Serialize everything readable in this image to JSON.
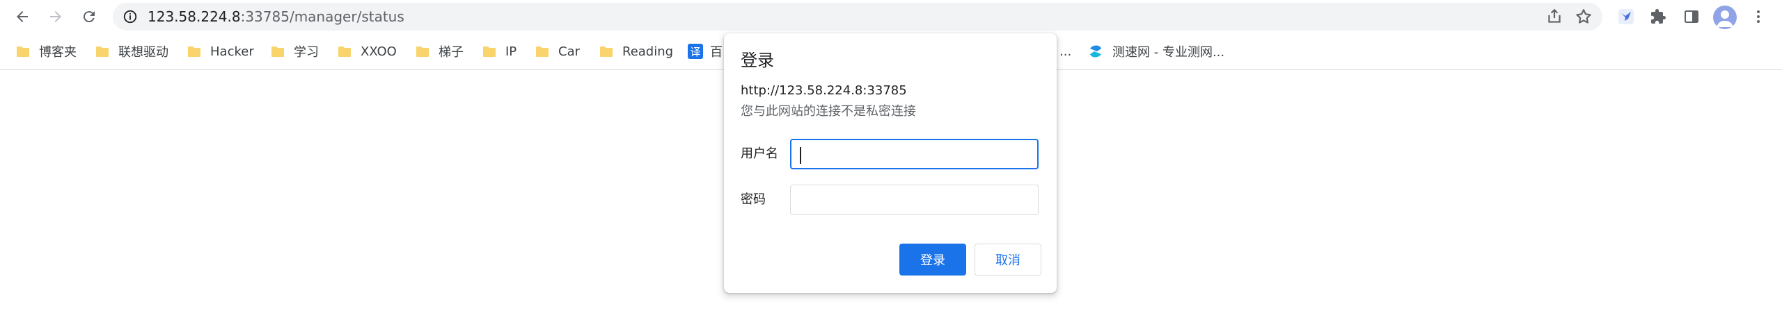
{
  "browser": {
    "url_host": "123.58.224.8",
    "url_rest": ":33785/manager/status"
  },
  "bookmarks": [
    {
      "label": "博客夹",
      "type": "folder"
    },
    {
      "label": "联想驱动",
      "type": "folder"
    },
    {
      "label": "Hacker",
      "type": "folder"
    },
    {
      "label": "学习",
      "type": "folder"
    },
    {
      "label": "XXOO",
      "type": "folder"
    },
    {
      "label": "梯子",
      "type": "folder"
    },
    {
      "label": "IP",
      "type": "folder"
    },
    {
      "label": "Car",
      "type": "folder"
    },
    {
      "label": "Reading",
      "type": "folder"
    },
    {
      "label": "百",
      "type": "translate",
      "icon_text": "译"
    },
    {
      "label": "...",
      "type": "text"
    },
    {
      "label": "测速网 - 专业测网...",
      "type": "speedtest"
    }
  ],
  "dialog": {
    "title": "登录",
    "origin": "http://123.58.224.8:33785",
    "warning": "您与此网站的连接不是私密连接",
    "username_label": "用户名",
    "username_value": "",
    "password_label": "密码",
    "password_value": "",
    "login_button": "登录",
    "cancel_button": "取消"
  },
  "colors": {
    "accent": "#1a73e8",
    "folder": "#f9d36b",
    "omnibox_bg": "#f1f3f4"
  }
}
